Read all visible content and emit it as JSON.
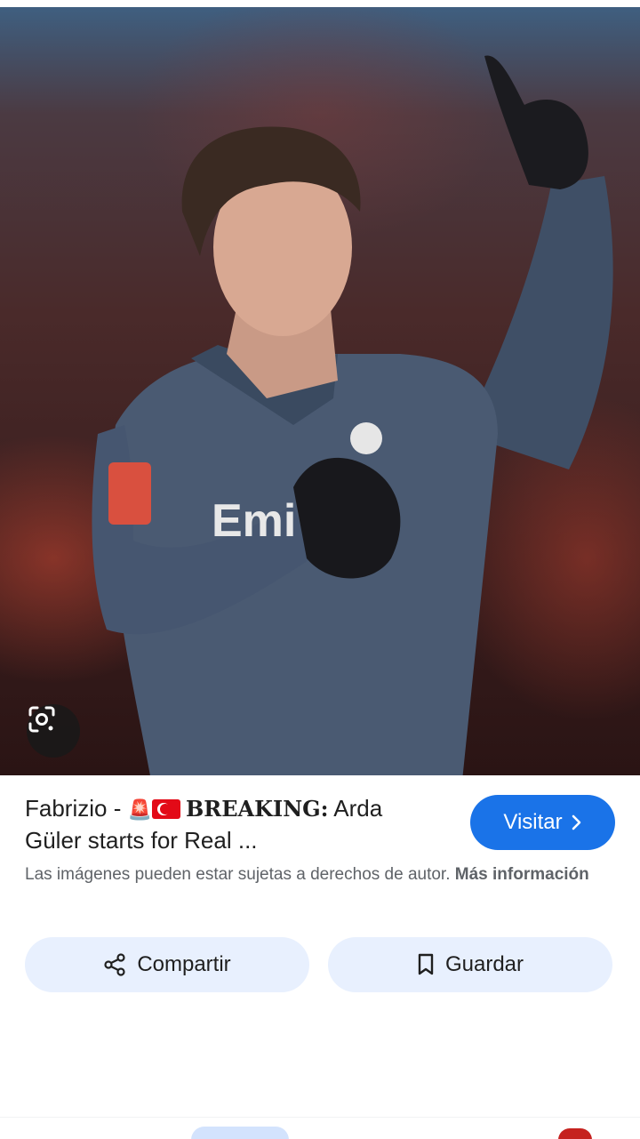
{
  "result": {
    "title_prefix": "Fabrizio - ",
    "title_siren": "🚨",
    "title_breaking": "BREAKING:",
    "title_line1_rest": " Arda",
    "title_line2": "Güler starts for Real ...",
    "visit_label": "Visitar",
    "copyright_text": "Las imágenes pueden estar sujetas a derechos de autor.",
    "more_info_label": "Más información"
  },
  "actions": {
    "share_label": "Compartir",
    "save_label": "Guardar"
  },
  "icons": {
    "lens": "google-lens-icon",
    "visit_chevron": "chevron-right-icon",
    "share": "share-icon",
    "save": "bookmark-icon"
  },
  "colors": {
    "accent": "#1a73e8",
    "pill_bg": "#e8f0fe",
    "secondary_text": "#5f6368"
  }
}
